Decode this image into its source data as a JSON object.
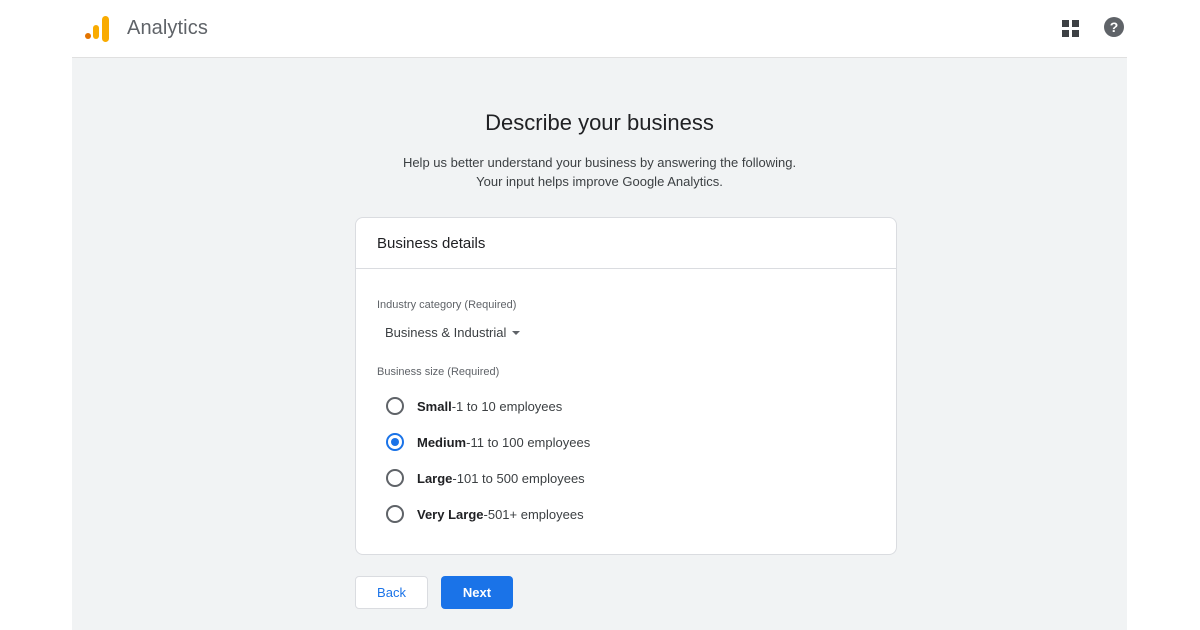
{
  "app": {
    "title": "Analytics"
  },
  "progress": {
    "fraction": 0.2
  },
  "page": {
    "title": "Describe your business",
    "subtitle_line1": "Help us better understand your business by answering the following.",
    "subtitle_line2": "Your input helps improve Google Analytics."
  },
  "card": {
    "header": "Business details",
    "industry": {
      "label": "Industry category (Required)",
      "value": "Business & Industrial"
    },
    "size": {
      "label": "Business size (Required)",
      "options": [
        {
          "name": "Small",
          "desc": "1 to 10 employees",
          "checked": false
        },
        {
          "name": "Medium",
          "desc": "11 to 100 employees",
          "checked": true
        },
        {
          "name": "Large",
          "desc": "101 to 500 employees",
          "checked": false
        },
        {
          "name": "Very Large",
          "desc": "501+ employees",
          "checked": false
        }
      ]
    }
  },
  "buttons": {
    "back": "Back",
    "next": "Next"
  },
  "icons": {
    "logo": "analytics-logo",
    "apps": "apps-grid-icon",
    "help": "help-icon"
  },
  "colors": {
    "accent": "#1a73e8",
    "logo_orange": "#f9ab00",
    "logo_dark": "#e37400"
  },
  "sep": " - "
}
